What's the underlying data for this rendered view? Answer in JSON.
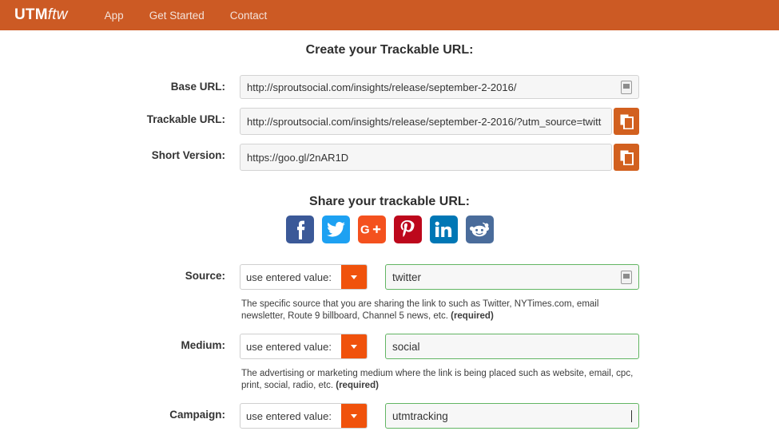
{
  "navbar": {
    "brand_bold": "UTM",
    "brand_italic": "ftw",
    "links": [
      {
        "label": "App"
      },
      {
        "label": "Get Started"
      },
      {
        "label": "Contact"
      }
    ],
    "background_color": "#cc5a24"
  },
  "create_section": {
    "title": "Create your Trackable URL:",
    "fields": [
      {
        "label": "Base URL:",
        "value": "http://sproutsocial.com/insights/release/september-2-2016/"
      },
      {
        "label": "Trackable URL:",
        "value": "http://sproutsocial.com/insights/release/september-2-2016/?utm_source=twitt"
      },
      {
        "label": "Short Version:",
        "value": "https://goo.gl/2nAR1D"
      }
    ]
  },
  "share_section": {
    "title": "Share your trackable URL:",
    "icons": [
      {
        "name": "facebook-icon",
        "color": "#3b5998"
      },
      {
        "name": "twitter-icon",
        "color": "#1da1f2"
      },
      {
        "name": "googleplus-icon",
        "color": "#f4511e"
      },
      {
        "name": "pinterest-icon",
        "color": "#bd081c"
      },
      {
        "name": "linkedin-icon",
        "color": "#0077b5"
      },
      {
        "name": "reddit-icon",
        "color": "#4a6c9b"
      }
    ]
  },
  "params": {
    "select_placeholder": "use entered value:",
    "rows": [
      {
        "label": "Source:",
        "select_value": "use entered value:",
        "value": "twitter",
        "help_lead": "The specific source that you are sharing the link to such as Twitter, NYTimes.com, email newsletter, Route 9 billboard, Channel 5 news, etc. ",
        "help_required": "(required)"
      },
      {
        "label": "Medium:",
        "select_value": "use entered value:",
        "value": "social",
        "help_lead": "The advertising or marketing medium where the link is being placed such as website, email, cpc, print, social, radio, etc. ",
        "help_required": "(required)"
      },
      {
        "label": "Campaign:",
        "select_value": "use entered value:",
        "value": "utmtracking",
        "help_lead": "",
        "help_required": ""
      }
    ]
  },
  "colors": {
    "brand_orange": "#cc5a24",
    "accent_orange": "#f0520c",
    "copy_button": "#d2601f",
    "valid_green": "#62b563"
  }
}
